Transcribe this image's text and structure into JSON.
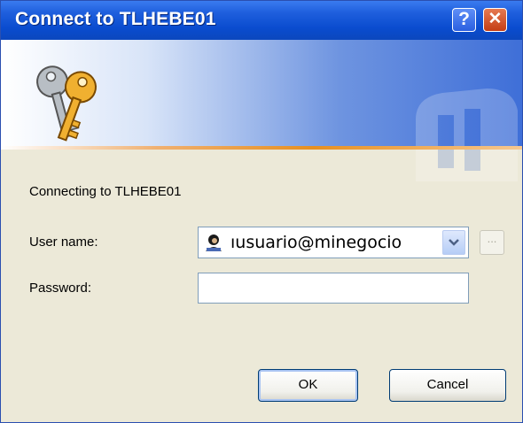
{
  "window": {
    "title": "Connect to TLHEBE01",
    "help_label": "?",
    "close_label": "✕"
  },
  "banner": {
    "icon": "keys-icon",
    "watermark": "watermark-icon"
  },
  "form": {
    "connecting_text": "Connecting to TLHEBE01",
    "user_label": "User name:",
    "user_value": "ıusuario@minegocio",
    "user_icon": "user-icon",
    "more_label": "...",
    "password_label": "Password:",
    "password_value": ""
  },
  "buttons": {
    "ok": "OK",
    "cancel": "Cancel"
  },
  "colors": {
    "titlebar": "#0a4ccf",
    "window_bg": "#ece9d8",
    "close": "#c43d15"
  }
}
